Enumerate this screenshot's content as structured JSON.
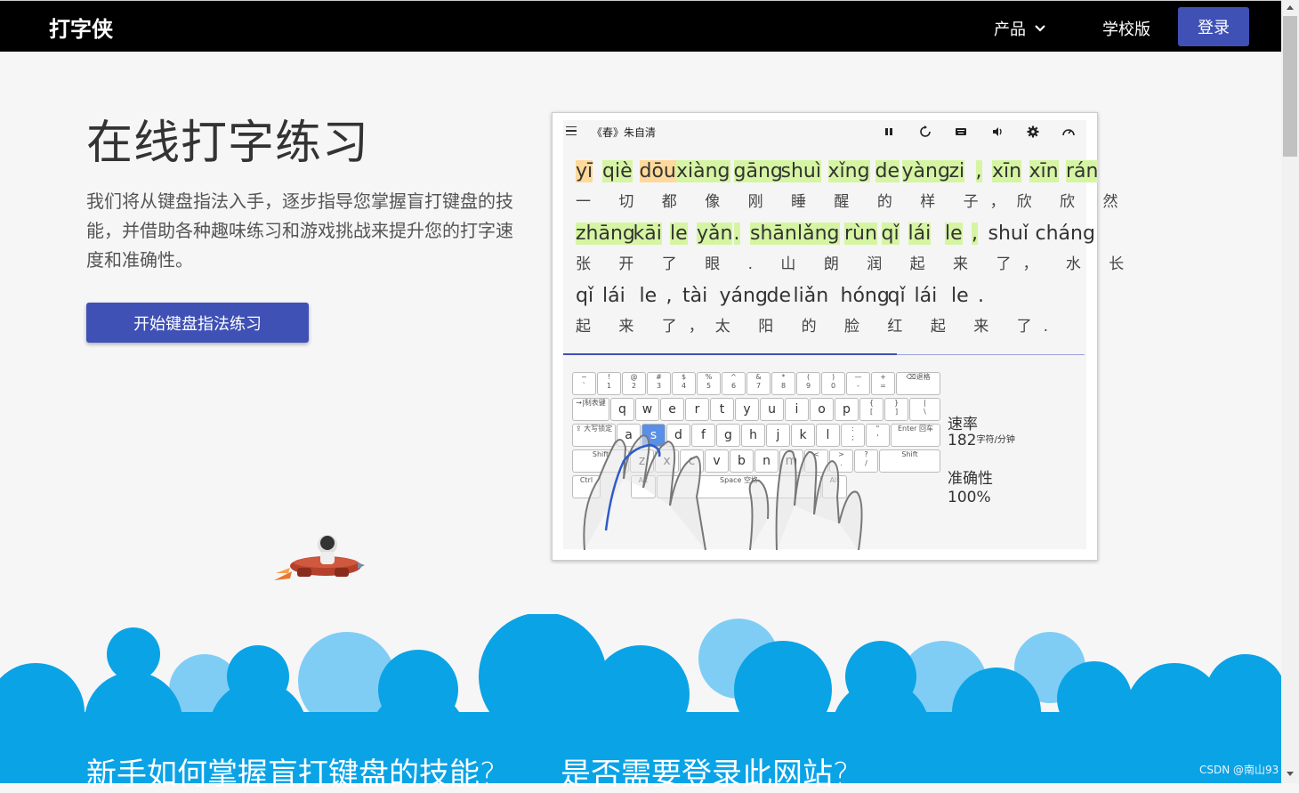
{
  "nav": {
    "brand": "打字侠",
    "product_label": "产品",
    "school_label": "学校版",
    "login_label": "登录"
  },
  "hero": {
    "title": "在线打字练习",
    "description": "我们将从键盘指法入手，逐步指导您掌握盲打键盘的技能，并借助各种趣味练习和游戏挑战来提升您的打字速度和准确性。",
    "start_button": "开始键盘指法练习"
  },
  "demo": {
    "title": "《春》朱自清",
    "toolbar_icons": [
      "pause-icon",
      "restart-icon",
      "keyboard-icon",
      "volume-icon",
      "settings-icon",
      "rocket-icon"
    ],
    "lines": [
      {
        "pinyin": [
          "yī",
          "qiè",
          "dōu",
          "xiàng",
          "gāng",
          "shuì",
          "xǐng",
          "de",
          "yàng",
          "zi",
          ",",
          "xīn",
          "xīn",
          "rán"
        ],
        "hanzi": "一 切 都  像  刚  睡  醒 的 样 子，欣 欣 然"
      },
      {
        "pinyin": [
          "zhāng",
          "kāi",
          "le",
          "yǎn",
          ".",
          "shān",
          "lǎng",
          "rùn",
          "qǐ",
          "lái",
          "le",
          ",",
          "shuǐ",
          "cháng"
        ],
        "hanzi": "张  开 了 眼 . 山  朗  润 起 来 了， 水   长"
      },
      {
        "pinyin": [
          "qǐ",
          "lái",
          "le",
          ",",
          "tài",
          "yáng",
          "de",
          "liǎn",
          "hóng",
          "qǐ",
          "lái",
          "le",
          "."
        ],
        "hanzi": "起 来 了，太  阳  的  脸  红  起 来 了."
      }
    ],
    "progress": 0.64,
    "stats": {
      "speed_label": "速率",
      "speed_value": "182",
      "speed_unit": "字符/分钟",
      "accuracy_label": "准确性",
      "accuracy_value": "100%"
    },
    "keyboard": {
      "row1": [
        [
          "~",
          "`"
        ],
        [
          "!",
          "1"
        ],
        [
          "@",
          "2"
        ],
        [
          "#",
          "3"
        ],
        [
          "$",
          "4"
        ],
        [
          "%",
          "5"
        ],
        [
          "^",
          "6"
        ],
        [
          "&",
          "7"
        ],
        [
          "*",
          "8"
        ],
        [
          "(",
          "9"
        ],
        [
          ")",
          "0"
        ],
        [
          "—",
          "-"
        ],
        [
          "+",
          "="
        ]
      ],
      "backspace": "⌫退格",
      "tab": "→|制表键",
      "row2": [
        "q",
        "w",
        "e",
        "r",
        "t",
        "y",
        "u",
        "i",
        "o",
        "p"
      ],
      "row2_sym": [
        [
          "{",
          "["
        ],
        [
          "}",
          "]"
        ],
        [
          "|",
          "\\"
        ]
      ],
      "caps": "⇪ 大写锁定",
      "row3": [
        "a",
        "s",
        "d",
        "f",
        "g",
        "h",
        "j",
        "k",
        "l"
      ],
      "row3_sym": [
        [
          ":",
          ";"
        ],
        [
          "\"",
          "'"
        ]
      ],
      "enter": "Enter 回车",
      "shift": "Shift",
      "row4": [
        "z",
        "x",
        "c",
        "v",
        "b",
        "n",
        "m"
      ],
      "row4_sym": [
        [
          "<",
          ","
        ],
        [
          ">",
          "."
        ],
        [
          "?",
          "/"
        ]
      ],
      "ctrl": "Ctrl",
      "alt": "Alt",
      "space": "Space 空格",
      "active_key": "s"
    }
  },
  "faq": {
    "q1": "新手如何掌握盲打键盘的技能?",
    "q2": "是否需要登录此网站?"
  },
  "watermark": "CSDN @南山93",
  "colors": {
    "accent": "#3f51b5",
    "cloud_dark": "#0aa3e6",
    "cloud_light": "#7fcdf5",
    "highlight_green": "#d6f5a3",
    "highlight_orange": "#ffd99b"
  }
}
